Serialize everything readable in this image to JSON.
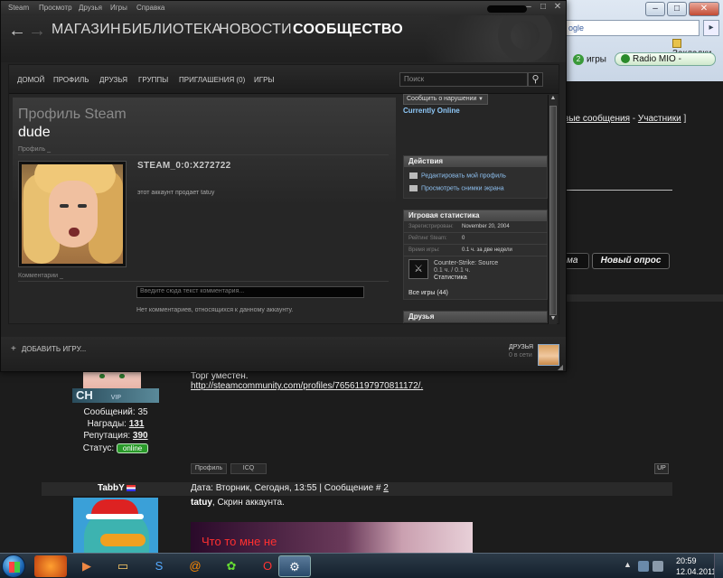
{
  "steam": {
    "menu": [
      "Steam",
      "Просмотр",
      "Друзья",
      "Игры",
      "Справка"
    ],
    "nav": [
      "МАГАЗИН",
      "БИБЛИОТЕКА",
      "НОВОСТИ",
      "СООБЩЕСТВО"
    ],
    "subnav": [
      "ДОМОЙ",
      "ПРОФИЛЬ",
      "ДРУЗЬЯ",
      "ГРУППЫ",
      "ПРИГЛАШЕНИЯ (0)",
      "ИГРЫ"
    ],
    "search_placeholder": "Поиск",
    "profile": {
      "title": "Профиль Steam",
      "name": "dude",
      "section_label": "Профиль _",
      "steam_id": "STEAM_0:0:X272722",
      "summary": "этот аккаунт продает tatuy",
      "comments_label": "Комментарии _",
      "comment_placeholder": "Введите сюда текст комментария...",
      "no_comments": "Нет комментариев, относящихся к данному аккаунту."
    },
    "side": {
      "report": "Сообщить о нарушении",
      "status": "Currently Online",
      "actions_title": "Действия",
      "actions": [
        "Редактировать мой профиль",
        "Просмотреть снимки экрана"
      ],
      "stats_title": "Игровая статистика",
      "stats": [
        {
          "k": "Зарегистрирован:",
          "v": "November 20, 2004"
        },
        {
          "k": "Рейтинг Steam:",
          "v": "0"
        },
        {
          "k": "Время игры:",
          "v": "0.1 ч. за две недели"
        }
      ],
      "game_name": "Counter-Strike: Source",
      "game_hours": "0.1 ч. / 0.1 ч.",
      "game_stats": "Статистика",
      "all_games": "Все игры (44)",
      "friends_title": "Друзья"
    },
    "footer": {
      "add_game": "ДОБАВИТЬ ИГРУ...",
      "friends": "ДРУЗЬЯ",
      "friends_online": "0 в сети"
    }
  },
  "browser": {
    "address": "ogle",
    "bookmarks": "Закладки",
    "games": "игры",
    "radio": "Radio MIO -",
    "forum_links": [
      "вые сообщения",
      " - ",
      "Участники",
      " ]"
    ],
    "btn_partial": "ма",
    "btn_new_poll": "Новый опрос"
  },
  "forum": {
    "post1": {
      "messages": "Сообщений: 35",
      "awards_label": "Награды: ",
      "awards": "131",
      "rep_label": "Репутация: ",
      "rep": "390",
      "status_label": "Статус: ",
      "status": "online",
      "text": "Торг уместен.",
      "link": "http://steamcommunity.com/profiles/76561197970811172/.",
      "buttons": [
        "Профиль",
        "ICQ"
      ],
      "up": "UP"
    },
    "post2": {
      "author": "TabbY",
      "date_prefix": "Дата: Вторник, Сегодня, 13:55 | Сообщение # ",
      "number": "2",
      "author_inline": "tatuy",
      "text": ", Скрин аккаунта.",
      "image_caption": "Что то мне не"
    }
  },
  "taskbar": {
    "time": "20:59",
    "date": "12.04.2011"
  },
  "colors": {
    "accent_link": "#8ec8f8",
    "online": "#2a9a2a",
    "caption_red": "#ff3030"
  }
}
